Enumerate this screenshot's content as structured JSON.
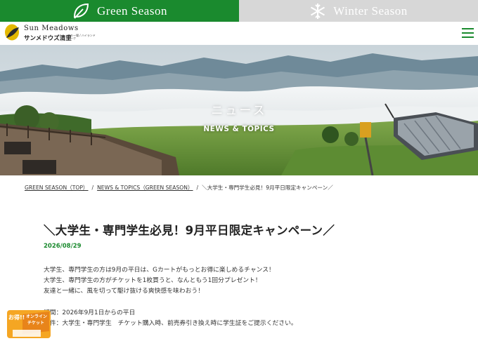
{
  "season_tabs": {
    "green_label": "Green Season",
    "winter_label": "Winter Season",
    "green_color": "#1a8a2e",
    "winter_color": "#d7d7d7"
  },
  "header": {
    "logo_en": "Sun Meadows",
    "logo_jp": "サンメドウズ清里",
    "logo_sub": "スキー場 / ハイランドパーク",
    "menu_icon": "hamburger-menu-icon"
  },
  "hero": {
    "title_jp": "ニュース",
    "title_en": "NEWS & TOPICS"
  },
  "breadcrumb": {
    "items": [
      "GREEN SEASON（TOP）",
      "NEWS & TOPICS（GREEN SEASON）",
      "＼大学生・専門学生必見！9月平日限定キャンペーン／"
    ],
    "separator": "/"
  },
  "article": {
    "title": "＼大学生・専門学生必見！9月平日限定キャンペーン／",
    "date": "2026/08/29",
    "paragraphs": [
      "大学生、専門学生の方は9月の平日は、Gカートがもっとお得に楽しめるチャンス！",
      "大学生、専門学生の方がチケットを1枚買うと、なんともう1回分プレゼント！",
      "友達と一緒に、風を切って駆け抜ける爽快感を味わおう！"
    ],
    "details": [
      "期間：2026年9月1日からの平日",
      "条件：大学生・専門学生　チケット購入時、前売券引き換え時に学生証をご提示ください。"
    ]
  },
  "badge": {
    "line1": "お得!!",
    "line2": "オンライン",
    "line3": "チケット"
  }
}
